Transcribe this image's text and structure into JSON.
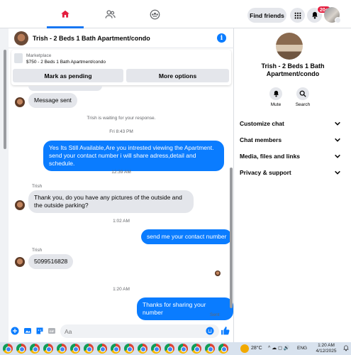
{
  "colors": {
    "accent": "#0a7cff",
    "brand": "#1877f2",
    "badge": "#e41e3f",
    "bubble_in": "#e4e6eb"
  },
  "topnav": {
    "icons": [
      "home-icon",
      "friends-icon",
      "groups-icon"
    ],
    "find_friends": "Find friends",
    "notifications_badge": "20+"
  },
  "chat": {
    "header": {
      "title": "Trish - 2 Beds 1 Bath Apartment/condo"
    },
    "listing": {
      "type": "Marketplace",
      "description": "$750 - 2 Beds 1 Bath Apartment/condo",
      "pending_button": "Mark as pending",
      "options_button": "More options"
    },
    "messages": {
      "m1": "Message sent",
      "waiting": "Trish is waiting for your response.",
      "time1": "Fri 8:43 PM",
      "m2": "Yes Its Still Available,Are you intrested viewing the Apartment. send your contact number i will share adress,detail and schedule.",
      "time2": "12:39 AM",
      "sender1": "Trish",
      "m3": "Thank you, do you have any pictures of the outside and the outside parking?",
      "time3": "1:02 AM",
      "m4": "send me your contact number",
      "sender2": "Trish",
      "m5": "5099516828",
      "time4": "1:20 AM",
      "m6": "Thanks for sharing your number",
      "status": "Sent"
    },
    "composer": {
      "placeholder": "Aa"
    }
  },
  "right_panel": {
    "name": "Trish - 2 Beds 1 Bath Apartment/condo",
    "actions": {
      "mute": "Mute",
      "search": "Search"
    },
    "sections": [
      "Customize chat",
      "Chat members",
      "Media, files and links",
      "Privacy & support"
    ]
  },
  "taskbar": {
    "temperature": "28°C",
    "tray": "^ ☁ ◻ 🔊",
    "language": "ENG",
    "time": "1:20 AM",
    "date": "4/12/2025"
  }
}
